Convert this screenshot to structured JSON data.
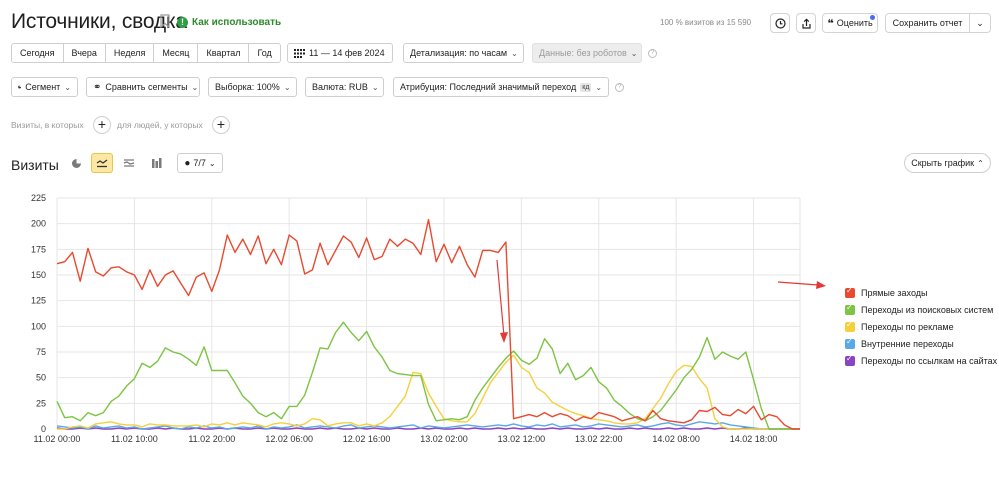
{
  "header": {
    "title": "Источники, сводка",
    "how_to_use": "Как использовать",
    "visits_percent": "100 % визитов из 15 590",
    "rate_label": "Оценить",
    "save_report_label": "Сохранить отчет"
  },
  "period_tabs": [
    "Сегодня",
    "Вчера",
    "Неделя",
    "Месяц",
    "Квартал",
    "Год"
  ],
  "date_range": "11 — 14 фев 2024",
  "detail": "Детализация: по часам",
  "data_filter": "Данные: без роботов",
  "toolbar2": {
    "segment": "Сегмент",
    "compare": "Сравнить сегменты",
    "sample": "Выборка: 100%",
    "currency": "Валюта: RUB",
    "attribution": "Атрибуция: Последний значимый переход",
    "attribution_tag": "кд"
  },
  "filters": {
    "visits_label": "Визиты, в которых",
    "people_label": "для людей, у которых"
  },
  "chart_header": {
    "title": "Визиты",
    "series_count": "7/7",
    "hide_chart": "Скрыть график"
  },
  "colors": {
    "direct": "#e8492f",
    "search": "#7cc443",
    "ads": "#f5d03c",
    "internal": "#5aa9e6",
    "links": "#8a44c2",
    "annotation": "#e53935",
    "grid": "#e6e6e6"
  },
  "chart_data": {
    "type": "line",
    "title": "",
    "xlabel": "",
    "ylabel": "",
    "ylim": [
      0,
      225
    ],
    "yticks": [
      0,
      25,
      50,
      75,
      100,
      125,
      150,
      175,
      200,
      225
    ],
    "x_tick_labels": [
      "11.02 00:00",
      "11.02 10:00",
      "11.02 20:00",
      "12.02 06:00",
      "12.02 16:00",
      "13.02 02:00",
      "13.02 12:00",
      "13.02 22:00",
      "14.02 08:00",
      "14.02 18:00"
    ],
    "x_tick_hours": [
      0,
      10,
      20,
      30,
      40,
      50,
      60,
      70,
      80,
      90
    ],
    "x_hours": [
      0,
      1,
      2,
      3,
      4,
      5,
      6,
      7,
      8,
      9,
      10,
      11,
      12,
      13,
      14,
      15,
      16,
      17,
      18,
      19,
      20,
      21,
      22,
      23,
      24,
      25,
      26,
      27,
      28,
      29,
      30,
      31,
      32,
      33,
      34,
      35,
      36,
      37,
      38,
      39,
      40,
      41,
      42,
      43,
      44,
      45,
      46,
      47,
      48,
      49,
      50,
      51,
      52,
      53,
      54,
      55,
      56,
      57,
      58,
      59,
      60,
      61,
      62,
      63,
      64,
      65,
      66,
      67,
      68,
      69,
      70,
      71,
      72,
      73,
      74,
      75,
      76,
      77,
      78,
      79,
      80,
      81,
      82,
      83,
      84,
      85,
      86,
      87,
      88,
      89,
      90,
      91,
      92,
      93,
      94,
      95,
      96
    ],
    "grid": true,
    "legend_position": "right",
    "series": [
      {
        "name": "Прямые заходы",
        "color_key": "direct",
        "values": [
          161,
          163,
          172,
          144,
          176,
          153,
          149,
          157,
          158,
          153,
          150,
          136,
          155,
          139,
          150,
          154,
          142,
          130,
          148,
          152,
          134,
          155,
          189,
          172,
          185,
          170,
          188,
          161,
          175,
          160,
          189,
          183,
          151,
          155,
          181,
          160,
          174,
          188,
          182,
          167,
          186,
          165,
          168,
          185,
          178,
          185,
          181,
          170,
          204,
          163,
          180,
          162,
          178,
          160,
          148,
          174,
          174,
          172,
          182,
          10,
          12,
          14,
          12,
          16,
          12,
          15,
          13,
          8,
          12,
          10,
          16,
          14,
          12,
          8,
          10,
          12,
          8,
          18,
          10,
          8,
          7,
          6,
          9,
          18,
          17,
          21,
          14,
          13,
          19,
          15,
          22,
          9,
          14,
          12,
          4,
          0,
          0
        ]
      },
      {
        "name": "Переходы из поисковых систем",
        "color_key": "search",
        "values": [
          27,
          11,
          12,
          8,
          16,
          13,
          16,
          27,
          32,
          42,
          49,
          64,
          60,
          66,
          79,
          75,
          73,
          68,
          62,
          80,
          57,
          57,
          57,
          45,
          32,
          25,
          16,
          12,
          16,
          10,
          22,
          22,
          33,
          55,
          79,
          78,
          94,
          104,
          94,
          86,
          95,
          80,
          70,
          57,
          54,
          53,
          52,
          52,
          24,
          8,
          9,
          10,
          9,
          12,
          28,
          40,
          50,
          60,
          69,
          76,
          67,
          63,
          69,
          88,
          78,
          54,
          64,
          48,
          52,
          60,
          46,
          40,
          28,
          22,
          15,
          10,
          8,
          12,
          18,
          28,
          38,
          50,
          58,
          70,
          89,
          68,
          75,
          71,
          68,
          75,
          48,
          20,
          0,
          0,
          0,
          0,
          0
        ]
      },
      {
        "name": "Переходы по рекламе",
        "color_key": "ads",
        "values": [
          0,
          0,
          2,
          3,
          1,
          5,
          6,
          7,
          5,
          4,
          4,
          2,
          5,
          4,
          4,
          3,
          3,
          3,
          4,
          2,
          5,
          4,
          6,
          4,
          6,
          5,
          4,
          2,
          5,
          6,
          5,
          3,
          5,
          10,
          9,
          3,
          5,
          6,
          6,
          3,
          5,
          3,
          6,
          12,
          22,
          32,
          55,
          54,
          35,
          22,
          10,
          8,
          7,
          7,
          15,
          30,
          45,
          55,
          65,
          72,
          60,
          55,
          40,
          35,
          26,
          22,
          18,
          15,
          13,
          10,
          9,
          8,
          6,
          5,
          5,
          6,
          10,
          20,
          30,
          44,
          56,
          62,
          61,
          49,
          40,
          10,
          2,
          0,
          0,
          0,
          0,
          0,
          0,
          0,
          0,
          0,
          0
        ]
      },
      {
        "name": "Внутренние переходы",
        "color_key": "internal",
        "values": [
          3,
          2,
          1,
          2,
          0,
          3,
          1,
          2,
          3,
          1,
          2,
          0,
          1,
          2,
          3,
          1,
          0,
          2,
          1,
          3,
          1,
          2,
          0,
          1,
          2,
          1,
          3,
          0,
          2,
          1,
          2,
          4,
          1,
          2,
          3,
          2,
          1,
          3,
          4,
          1,
          2,
          3,
          2,
          1,
          2,
          3,
          4,
          1,
          3,
          2,
          1,
          2,
          3,
          4,
          3,
          2,
          3,
          4,
          3,
          5,
          3,
          2,
          4,
          3,
          5,
          2,
          3,
          4,
          2,
          3,
          5,
          4,
          3,
          2,
          3,
          4,
          2,
          3,
          5,
          6,
          4,
          3,
          5,
          7,
          6,
          5,
          6,
          4,
          3,
          2,
          1,
          0,
          0,
          0,
          0,
          0,
          0
        ]
      },
      {
        "name": "Переходы по ссылкам на сайтах",
        "color_key": "links",
        "values": [
          1,
          0,
          0,
          1,
          0,
          1,
          0,
          0,
          1,
          0,
          1,
          0,
          0,
          1,
          0,
          1,
          0,
          0,
          1,
          0,
          0,
          1,
          0,
          1,
          0,
          0,
          1,
          0,
          1,
          0,
          0,
          1,
          0,
          0,
          1,
          0,
          1,
          0,
          0,
          1,
          0,
          1,
          0,
          0,
          1,
          0,
          0,
          1,
          0,
          1,
          0,
          0,
          1,
          0,
          1,
          0,
          0,
          1,
          0,
          1,
          0,
          1,
          0,
          0,
          1,
          0,
          1,
          0,
          0,
          1,
          0,
          1,
          0,
          0,
          1,
          0,
          1,
          0,
          0,
          1,
          0,
          1,
          0,
          0,
          1,
          0,
          1,
          0,
          0,
          1,
          0,
          0,
          0,
          0,
          0,
          0,
          0
        ]
      }
    ]
  }
}
